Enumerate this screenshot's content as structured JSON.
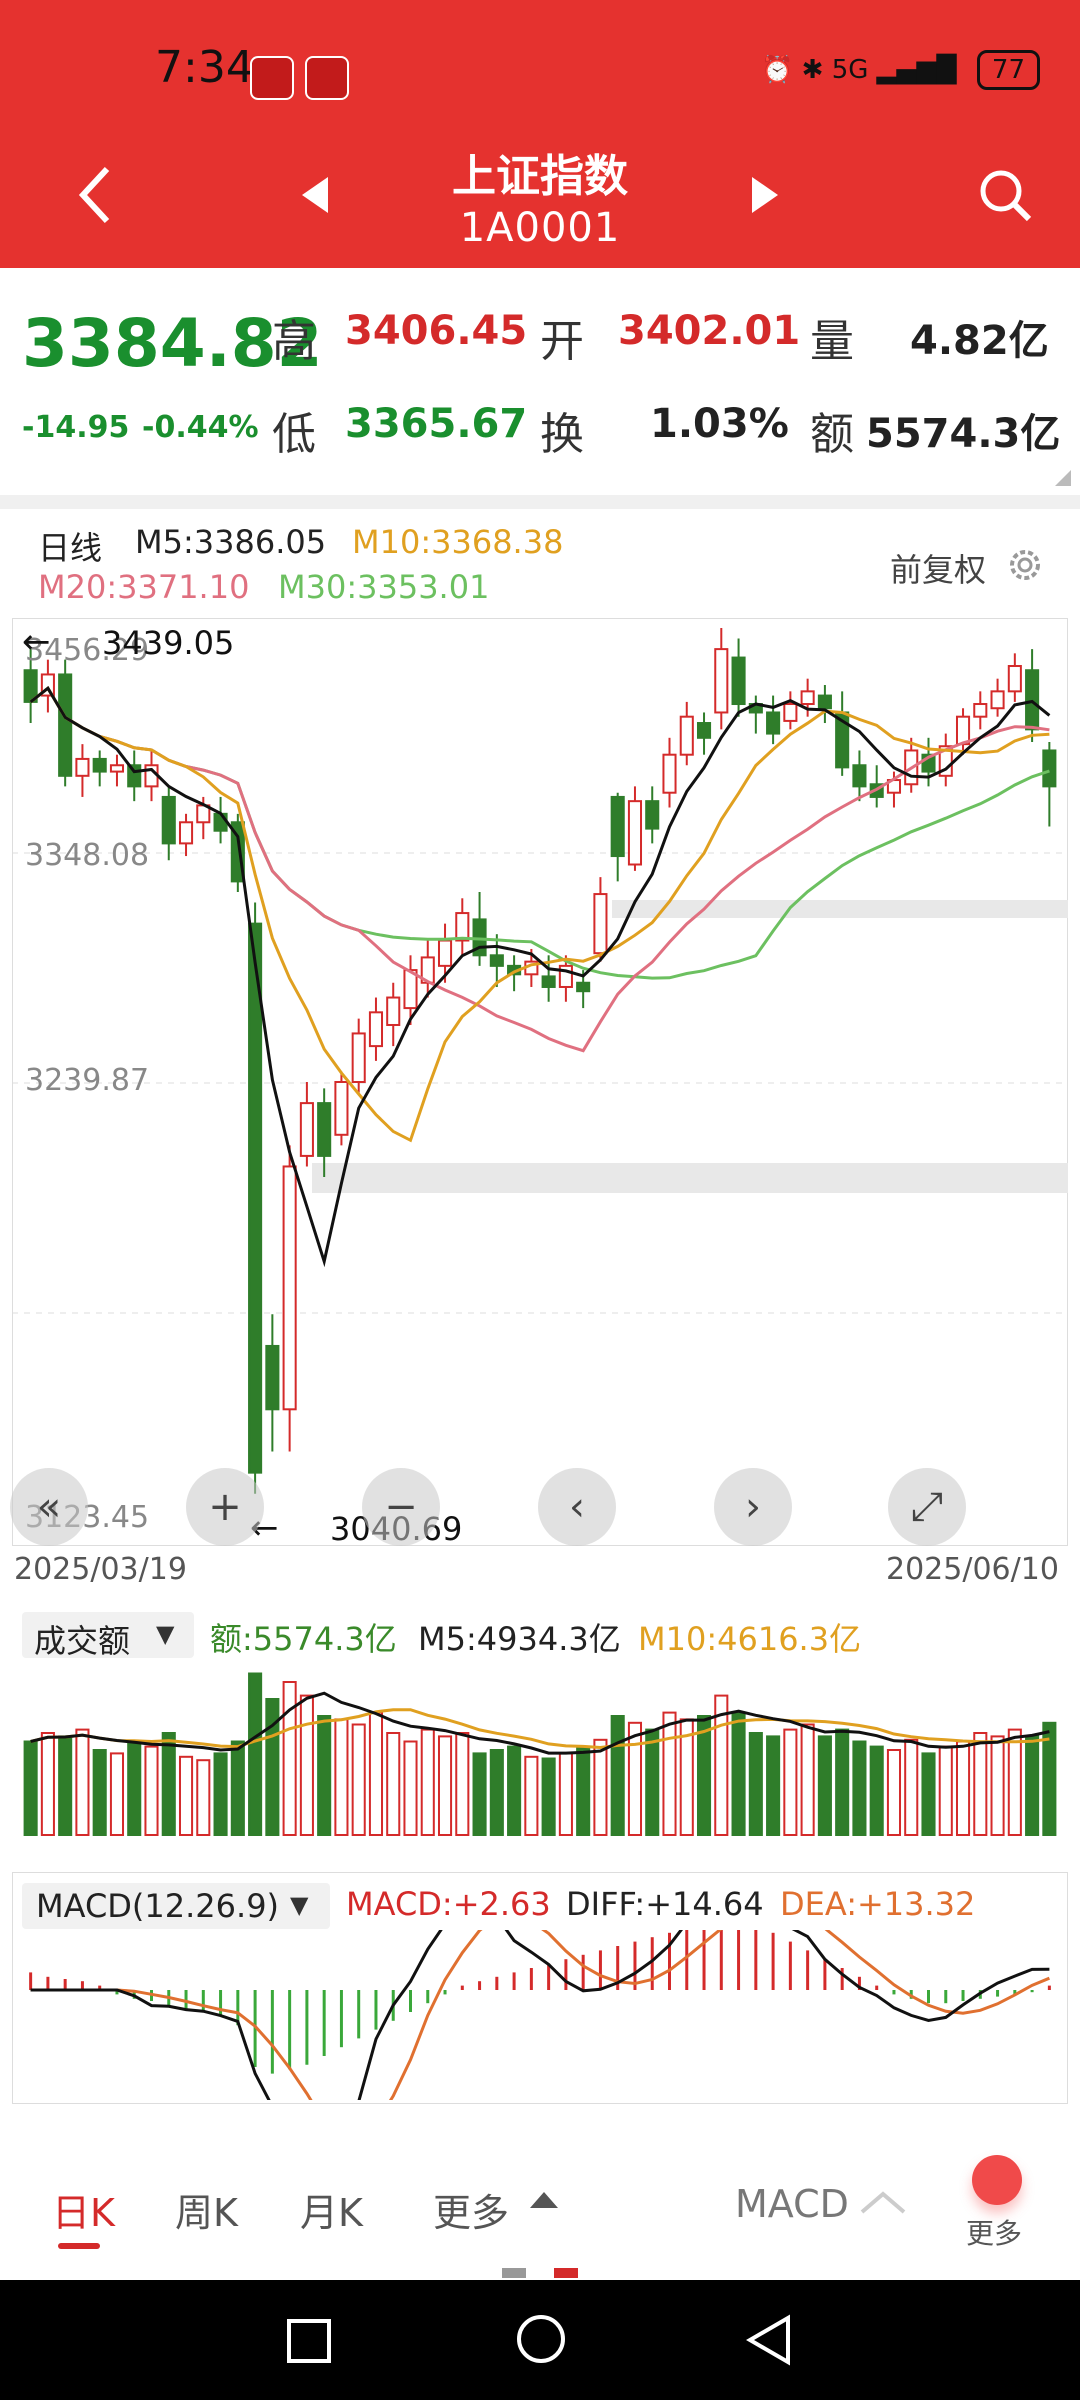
{
  "status": {
    "time": "7:34",
    "network": "5G",
    "battery": "77"
  },
  "header": {
    "title": "上证指数",
    "code": "1A0001"
  },
  "quote": {
    "price": "3384.82",
    "change": "-14.95",
    "change_pct": "-0.44%",
    "high_label": "高",
    "high": "3406.45",
    "open_label": "开",
    "open": "3402.01",
    "volume_label": "量",
    "volume": "4.82亿",
    "low_label": "低",
    "low": "3365.67",
    "turnover_label": "换",
    "turnover": "1.03%",
    "amount_label": "额",
    "amount": "5574.3亿"
  },
  "kline": {
    "period": "日线",
    "m5": "M5:3386.05",
    "m10": "M10:3368.38",
    "m20": "M20:3371.10",
    "m30": "M30:3353.01",
    "adjust": "前复权",
    "max_marker": "3439.05",
    "min_marker": "3040.69",
    "y_ticks": [
      "3456.29",
      "3348.08",
      "3239.87",
      "3123.45"
    ],
    "date_start": "2025/03/19",
    "date_end": "2025/06/10",
    "colors": {
      "m5": "#111111",
      "m10": "#e0a020",
      "m20": "#e07080",
      "m30": "#6cc060",
      "up": "#d42a2a",
      "down": "#2f7d2a"
    }
  },
  "volume": {
    "selector": "成交额",
    "amount": "额:5574.3亿",
    "m5": "M5:4934.3亿",
    "m10": "M10:4616.3亿"
  },
  "macd": {
    "selector": "MACD(12.26.9)",
    "macd": "MACD:+2.63",
    "diff": "DIFF:+14.64",
    "dea": "DEA:+13.32"
  },
  "tabs": {
    "day": "日K",
    "week": "周K",
    "month": "月K",
    "more": "更多",
    "indicator": "MACD",
    "more_btn": "更多"
  },
  "chart_data": {
    "type": "candlestick",
    "x_range": [
      "2025/03/19",
      "2025/06/10"
    ],
    "y_ticks": [
      3456.29,
      3348.08,
      3239.87,
      3123.45
    ],
    "ohlc": [
      [
        3440,
        3425,
        3450,
        3415
      ],
      [
        3428,
        3438,
        3445,
        3420
      ],
      [
        3438,
        3390,
        3445,
        3385
      ],
      [
        3390,
        3398,
        3405,
        3380
      ],
      [
        3398,
        3392,
        3402,
        3385
      ],
      [
        3392,
        3395,
        3400,
        3385
      ],
      [
        3395,
        3385,
        3402,
        3378
      ],
      [
        3385,
        3395,
        3402,
        3378
      ],
      [
        3380,
        3358,
        3385,
        3350
      ],
      [
        3358,
        3368,
        3372,
        3352
      ],
      [
        3368,
        3376,
        3380,
        3360
      ],
      [
        3372,
        3364,
        3380,
        3358
      ],
      [
        3368,
        3340,
        3372,
        3335
      ],
      [
        3320,
        3060,
        3330,
        3050
      ],
      [
        3120,
        3090,
        3135,
        3070
      ],
      [
        3090,
        3205,
        3215,
        3070
      ],
      [
        3210,
        3235,
        3245,
        3205
      ],
      [
        3235,
        3210,
        3242,
        3200
      ],
      [
        3220,
        3245,
        3250,
        3215
      ],
      [
        3245,
        3268,
        3275,
        3240
      ],
      [
        3262,
        3278,
        3285,
        3255
      ],
      [
        3272,
        3285,
        3292,
        3262
      ],
      [
        3280,
        3298,
        3305,
        3272
      ],
      [
        3292,
        3304,
        3312,
        3285
      ],
      [
        3300,
        3312,
        3320,
        3292
      ],
      [
        3312,
        3325,
        3332,
        3305
      ],
      [
        3322,
        3305,
        3335,
        3300
      ],
      [
        3305,
        3300,
        3315,
        3290
      ],
      [
        3300,
        3296,
        3305,
        3288
      ],
      [
        3296,
        3302,
        3308,
        3290
      ],
      [
        3295,
        3290,
        3305,
        3283
      ],
      [
        3290,
        3300,
        3305,
        3283
      ],
      [
        3292,
        3288,
        3298,
        3280
      ],
      [
        3306,
        3334,
        3342,
        3302
      ],
      [
        3380,
        3352,
        3382,
        3340
      ],
      [
        3348,
        3378,
        3385,
        3345
      ],
      [
        3378,
        3365,
        3385,
        3358
      ],
      [
        3382,
        3400,
        3408,
        3375
      ],
      [
        3400,
        3418,
        3425,
        3395
      ],
      [
        3415,
        3408,
        3420,
        3400
      ],
      [
        3420,
        3450,
        3460,
        3412
      ],
      [
        3446,
        3424,
        3455,
        3418
      ],
      [
        3424,
        3420,
        3428,
        3410
      ],
      [
        3420,
        3410,
        3428,
        3405
      ],
      [
        3416,
        3424,
        3430,
        3412
      ],
      [
        3424,
        3430,
        3436,
        3418
      ],
      [
        3428,
        3422,
        3433,
        3415
      ],
      [
        3420,
        3394,
        3430,
        3390
      ],
      [
        3395,
        3385,
        3402,
        3378
      ],
      [
        3386,
        3380,
        3395,
        3375
      ],
      [
        3382,
        3388,
        3392,
        3375
      ],
      [
        3386,
        3402,
        3408,
        3382
      ],
      [
        3400,
        3392,
        3408,
        3385
      ],
      [
        3390,
        3404,
        3410,
        3385
      ],
      [
        3405,
        3418,
        3422,
        3400
      ],
      [
        3418,
        3424,
        3430,
        3412
      ],
      [
        3422,
        3430,
        3436,
        3418
      ],
      [
        3430,
        3442,
        3448,
        3425
      ],
      [
        3440,
        3412,
        3450,
        3406
      ],
      [
        3402,
        3385,
        3406,
        3366
      ]
    ],
    "volume": [
      55,
      60,
      58,
      62,
      50,
      48,
      55,
      52,
      60,
      46,
      44,
      48,
      55,
      95,
      80,
      90,
      82,
      70,
      68,
      65,
      72,
      60,
      55,
      62,
      58,
      60,
      48,
      50,
      52,
      46,
      45,
      48,
      52,
      56,
      70,
      66,
      62,
      72,
      68,
      70,
      82,
      72,
      60,
      58,
      62,
      65,
      58,
      62,
      55,
      52,
      50,
      56,
      48,
      52,
      55,
      60,
      58,
      62,
      58,
      66
    ],
    "macd_hist": [
      8,
      6,
      5,
      4,
      2,
      -2,
      -4,
      -5,
      -7,
      -9,
      -10,
      -12,
      -16,
      -35,
      -38,
      -36,
      -34,
      -30,
      -26,
      -22,
      -18,
      -14,
      -10,
      -6,
      -2,
      2,
      4,
      6,
      8,
      10,
      12,
      14,
      16,
      18,
      20,
      22,
      24,
      26,
      28,
      30,
      32,
      30,
      28,
      26,
      22,
      18,
      14,
      10,
      6,
      2,
      -2,
      -4,
      -6,
      -6,
      -5,
      -4,
      -3,
      -2,
      -1,
      2
    ]
  }
}
